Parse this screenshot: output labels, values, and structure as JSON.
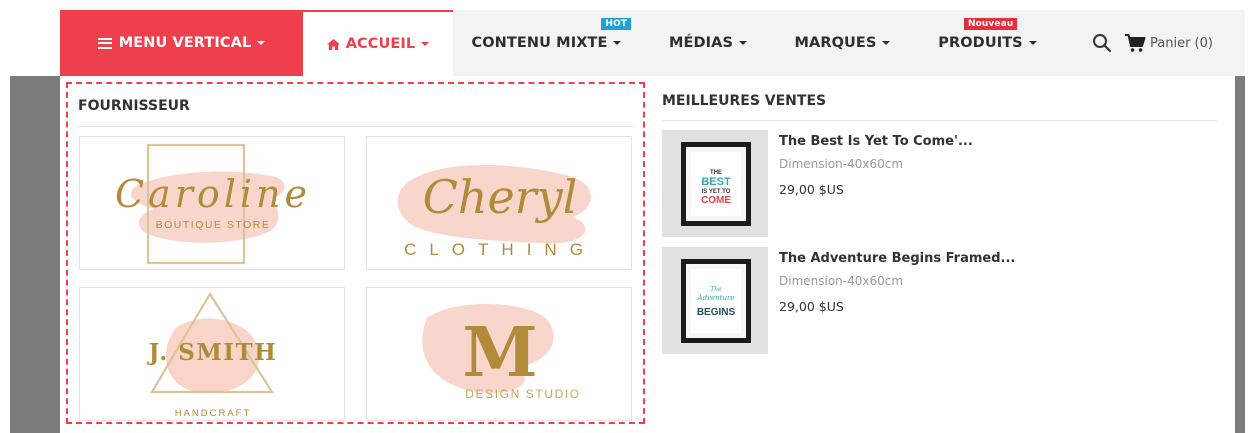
{
  "nav": {
    "vertical_menu": "MENU VERTICAL",
    "home": "ACCUEIL",
    "mixed": "CONTENU MIXTE",
    "mixed_badge": "HOT",
    "medias": "MÉDIAS",
    "brands": "MARQUES",
    "products": "PRODUITS",
    "products_badge": "Nouveau",
    "cart": "Panier (0)"
  },
  "suppliers": {
    "title": "FOURNISSEUR",
    "logos": [
      {
        "name": "Caroline",
        "tagline": "BOUTIQUE STORE"
      },
      {
        "name": "Cheryl",
        "tagline": "CLOTHING"
      },
      {
        "name": "J. SMITH",
        "tagline": "HANDCRAFT"
      },
      {
        "name": "M",
        "tagline": "DESIGN STUDIO"
      }
    ]
  },
  "bestsellers": {
    "title": "MEILLEURES VENTES",
    "items": [
      {
        "name": "The Best Is Yet To Come'...",
        "dimension": "Dimension-40x60cm",
        "price": "29,00 $US",
        "poster_words": [
          "THE",
          "BEST",
          "IS YET TO",
          "COME"
        ]
      },
      {
        "name": "The Adventure Begins Framed...",
        "dimension": "Dimension-40x60cm",
        "price": "29,00 $US",
        "poster_words": [
          "The",
          "Adventure",
          "BEGINS"
        ]
      }
    ]
  },
  "colors": {
    "accent": "#ef3f4c",
    "gold": "#b18a3a",
    "blush": "#f7cfc3",
    "hot_badge": "#1fa3d6"
  }
}
